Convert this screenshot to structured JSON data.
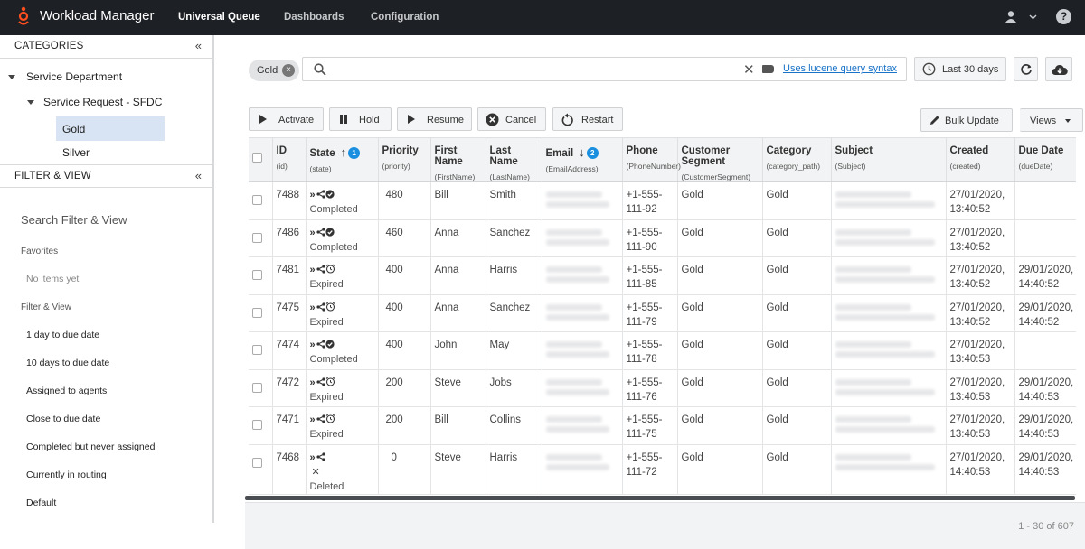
{
  "app": {
    "title": "Workload Manager"
  },
  "nav": {
    "tabs": [
      "Universal Queue",
      "Dashboards",
      "Configuration"
    ],
    "active": 0
  },
  "sidebar": {
    "categories_header": "CATEGORIES",
    "tree": {
      "root": "Service Department",
      "child": "Service Request - SFDC",
      "leaves": [
        "Gold",
        "Silver"
      ],
      "selected": "Gold"
    },
    "filter_header": "FILTER & VIEW",
    "search_filter": "Search Filter & View",
    "favorites_label": "Favorites",
    "no_items": "No items yet",
    "filter_view_label": "Filter & View",
    "filters": [
      "1 day to due date",
      "10 days to due date",
      "Assigned to agents",
      "Close to due date",
      "Completed but never assigned",
      "Currently in routing",
      "Default"
    ]
  },
  "toolbar": {
    "chip": "Gold",
    "search_value": "",
    "lucene_link": "Uses lucene query syntax",
    "range": "Last 30 days",
    "actions": [
      "Activate",
      "Hold",
      "Resume",
      "Cancel",
      "Restart"
    ],
    "bulk_update": "Bulk Update",
    "views": "Views"
  },
  "table": {
    "columns": [
      {
        "title": "ID",
        "field": "(id)"
      },
      {
        "title": "State",
        "field": "(state)",
        "sort": "asc",
        "badge": "1"
      },
      {
        "title": "Priority",
        "field": "(priority)"
      },
      {
        "title": "First Name",
        "field": "(FirstName)"
      },
      {
        "title": "Last Name",
        "field": "(LastName)"
      },
      {
        "title": "Email",
        "field": "(EmailAddress)",
        "sort": "desc",
        "badge": "2"
      },
      {
        "title": "Phone",
        "field": "(PhoneNumber)"
      },
      {
        "title": "Customer Segment",
        "field": "(CustomerSegment)"
      },
      {
        "title": "Category",
        "field": "(category_path)"
      },
      {
        "title": "Subject",
        "field": "(Subject)"
      },
      {
        "title": "Created",
        "field": "(created)"
      },
      {
        "title": "Due Date",
        "field": "(dueDate)"
      }
    ],
    "rows": [
      {
        "id": "7488",
        "state": "Completed",
        "state_icon": "check-circle-icon",
        "priority": "480",
        "first": "Bill",
        "last": "Smith",
        "phone": "+1-555-111-92",
        "segment": "Gold",
        "category": "Gold",
        "created": "27/01/2020, 13:40:52",
        "due": ""
      },
      {
        "id": "7486",
        "state": "Completed",
        "state_icon": "check-circle-icon",
        "priority": "460",
        "first": "Anna",
        "last": "Sanchez",
        "phone": "+1-555-111-90",
        "segment": "Gold",
        "category": "Gold",
        "created": "27/01/2020, 13:40:52",
        "due": ""
      },
      {
        "id": "7481",
        "state": "Expired",
        "state_icon": "alarm-icon",
        "priority": "400",
        "first": "Anna",
        "last": "Harris",
        "phone": "+1-555-111-85",
        "segment": "Gold",
        "category": "Gold",
        "created": "27/01/2020, 13:40:52",
        "due": "29/01/2020, 14:40:52"
      },
      {
        "id": "7475",
        "state": "Expired",
        "state_icon": "alarm-icon",
        "priority": "400",
        "first": "Anna",
        "last": "Sanchez",
        "phone": "+1-555-111-79",
        "segment": "Gold",
        "category": "Gold",
        "created": "27/01/2020, 13:40:52",
        "due": "29/01/2020, 14:40:52"
      },
      {
        "id": "7474",
        "state": "Completed",
        "state_icon": "check-circle-icon",
        "priority": "400",
        "first": "John",
        "last": "May",
        "phone": "+1-555-111-78",
        "segment": "Gold",
        "category": "Gold",
        "created": "27/01/2020, 13:40:53",
        "due": ""
      },
      {
        "id": "7472",
        "state": "Expired",
        "state_icon": "alarm-icon",
        "priority": "200",
        "first": "Steve",
        "last": "Jobs",
        "phone": "+1-555-111-76",
        "segment": "Gold",
        "category": "Gold",
        "created": "27/01/2020, 13:40:53",
        "due": "29/01/2020, 14:40:53"
      },
      {
        "id": "7471",
        "state": "Expired",
        "state_icon": "alarm-icon",
        "priority": "200",
        "first": "Bill",
        "last": "Collins",
        "phone": "+1-555-111-75",
        "segment": "Gold",
        "category": "Gold",
        "created": "27/01/2020, 13:40:53",
        "due": "29/01/2020, 14:40:53"
      },
      {
        "id": "7468",
        "state": "Deleted",
        "state_icon": "x-icon",
        "priority": "0",
        "first": "Steve",
        "last": "Harris",
        "phone": "+1-555-111-72",
        "segment": "Gold",
        "category": "Gold",
        "created": "27/01/2020, 14:40:53",
        "due": "29/01/2020, 14:40:53"
      }
    ]
  },
  "pagination": "1 - 30 of 607",
  "colors": {
    "topbar": "#1d2024",
    "accent": "#e0442d",
    "link": "#1a73c8",
    "badge": "#1a8fe0",
    "selected": "#d8e4f3"
  }
}
